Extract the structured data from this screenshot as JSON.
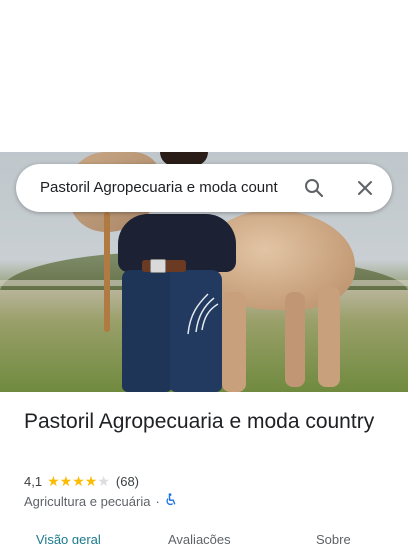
{
  "search": {
    "query": "Pastoril Agropecuaria e moda count",
    "search_icon": "search-icon",
    "clear_icon": "close-icon"
  },
  "place": {
    "name": "Pastoril Agropecuaria e moda country",
    "rating": "4,1",
    "rating_value": 4.1,
    "stars_max": 5,
    "review_count": "(68)",
    "category": "Agricultura e pecuária",
    "separator": "·",
    "accessibility_icon": "wheelchair-icon"
  },
  "tabs": [
    {
      "label": "Visão geral",
      "active": true
    },
    {
      "label": "Avaliações",
      "active": false
    },
    {
      "label": "Sobre",
      "active": false
    }
  ],
  "colors": {
    "star": "#fbbc04",
    "accent": "#1b7a8c",
    "accessibility": "#1a73e8"
  }
}
